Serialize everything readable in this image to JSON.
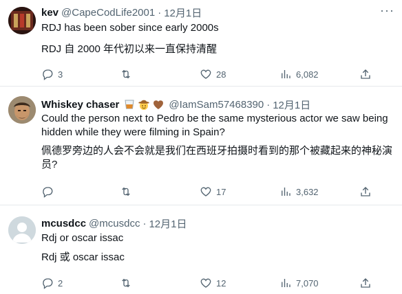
{
  "tweets": [
    {
      "name": "kev",
      "handle": "@CapeCodLife2001",
      "dot": "·",
      "date": "12月1日",
      "text": "RDJ has been sober since early 2000s",
      "translation": "RDJ 自 2000 年代初以来一直保持清醒",
      "replies": "3",
      "retweets": "",
      "likes": "28",
      "views": "6,082"
    },
    {
      "name": "Whiskey chaser",
      "handle": "@IamSam57468390",
      "dot": "·",
      "date": "12月1日",
      "text_line1": "Could the person next to Pedro be the same mysterious actor we saw being",
      "text_line2": "hidden while they were filming in Spain?",
      "translation_line1": "佩德罗旁边的人会不会就是我们在西班牙拍摄时看到的那个被藏起来的神秘演",
      "translation_line2": "员?",
      "replies": "",
      "retweets": "",
      "likes": "17",
      "views": "3,632"
    },
    {
      "name": "mcusdcc",
      "handle": "@mcusdcc",
      "dot": "·",
      "date": "12月1日",
      "text": "Rdj or oscar issac",
      "translation": "Rdj 或 oscar issac",
      "replies": "2",
      "retweets": "",
      "likes": "12",
      "views": "7,070"
    }
  ],
  "icons": {
    "reply": "reply-icon",
    "retweet": "retweet-icon",
    "like": "heart-icon",
    "views": "views-icon",
    "share": "share-icon",
    "more": "more-icon"
  },
  "colors": {
    "text": "#0f1419",
    "secondary": "#536471",
    "separator": "#e6e9ec"
  }
}
